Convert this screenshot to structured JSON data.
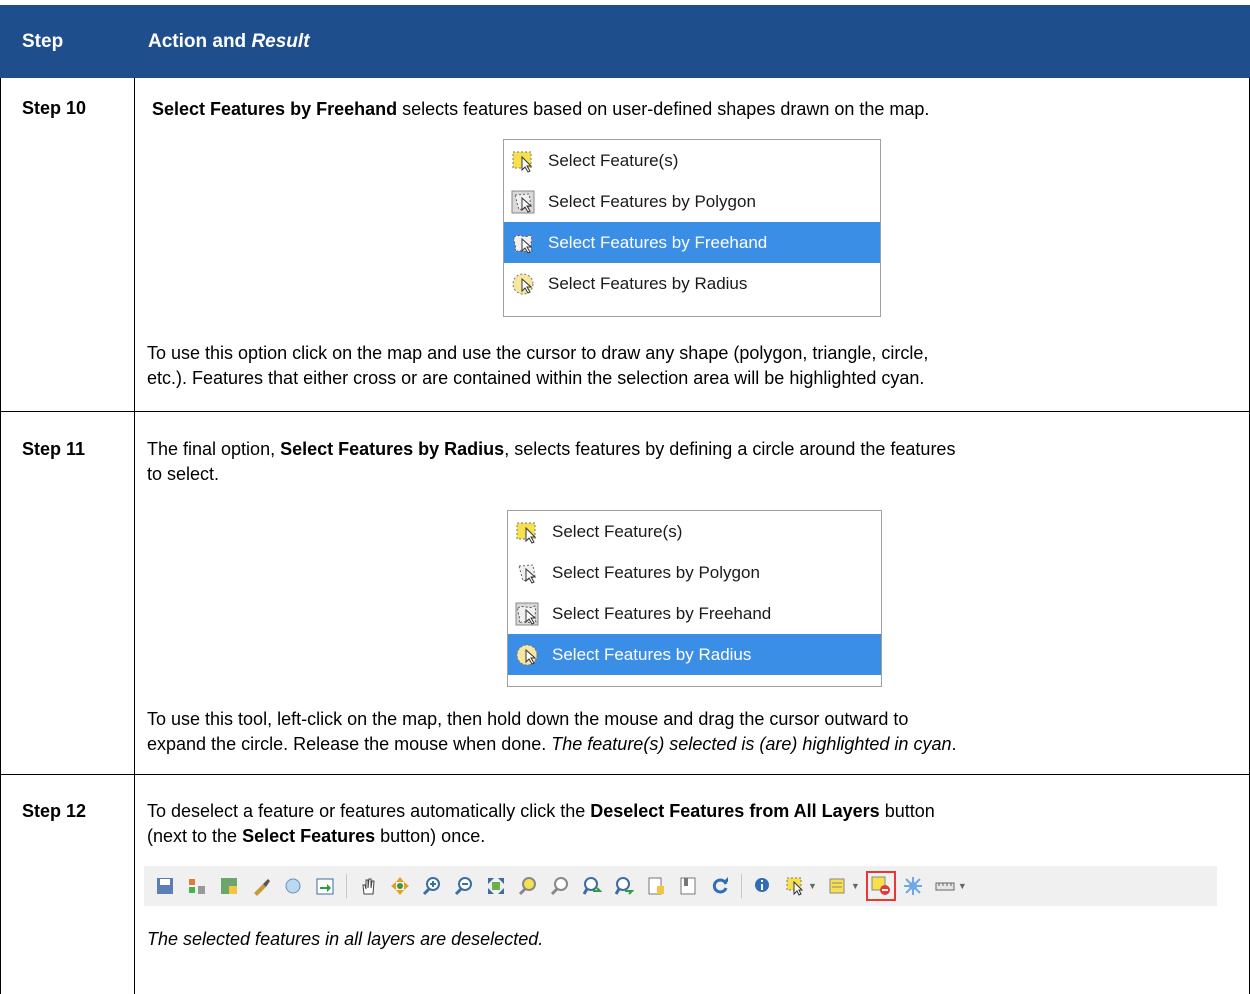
{
  "header": {
    "col_step": "Step",
    "col_action": "Action and ",
    "col_action_italic": "Result"
  },
  "rows": [
    {
      "step": "Step 10",
      "intro_bold": "Select Features by Freehand",
      "intro_rest": " selects features based on user-defined shapes drawn on the map.",
      "menu": [
        "Select Feature(s)",
        "Select Features by Polygon",
        "Select Features by Freehand",
        "Select Features by Radius"
      ],
      "selected_index": 2,
      "body_line1": "To use this option click on the map and use the cursor to draw any shape (polygon, triangle, circle,",
      "body_line2": "etc.). Features that either cross or are contained within the selection area will be highlighted cyan."
    },
    {
      "step": "Step 11",
      "intro_pre": "The final option, ",
      "intro_bold": "Select Features by Radius",
      "intro_rest": ", selects features by defining a circle around the features",
      "intro_line2": "to select.",
      "menu": [
        "Select Feature(s)",
        "Select Features by Polygon",
        "Select Features by Freehand",
        "Select Features by Radius"
      ],
      "selected_index": 3,
      "body_line1": "To use this tool, left-click on the map, then hold down the mouse and drag the cursor outward to",
      "body_line2_pre": "expand the circle. Release the mouse when done. ",
      "body_line2_italic": "The feature(s) selected is (are) highlighted in cyan",
      "body_line2_post": "."
    },
    {
      "step": "Step 12",
      "intro_pre": "To deselect a feature or features automatically click the ",
      "intro_bold": "Deselect Features from All Layers",
      "intro_rest": " button",
      "intro_line2_pre": "(next to the ",
      "intro_line2_bold": "Select Features",
      "intro_line2_post": " button) once.",
      "result_italic": "The selected features in all layers are deselected."
    }
  ],
  "colors": {
    "header_bg": "#1f4e8c",
    "selection_bg": "#3b8ee6",
    "highlight_border": "#e53935"
  },
  "toolbar_icons": [
    "save-project-icon",
    "style-manager-icon",
    "new-map-icon",
    "brush-icon",
    "print-icon",
    "export-icon",
    "pan-hand-icon",
    "pan-to-selection-icon",
    "zoom-in-icon",
    "zoom-out-icon",
    "zoom-full-icon",
    "zoom-to-selection-icon",
    "zoom-to-layer-icon",
    "zoom-last-icon",
    "zoom-next-icon",
    "new-bookmark-icon",
    "show-bookmarks-icon",
    "refresh-icon",
    "identify-icon",
    "select-features-icon",
    "select-by-value-icon",
    "deselect-all-layers-icon",
    "attribute-table-icon",
    "measure-icon"
  ]
}
